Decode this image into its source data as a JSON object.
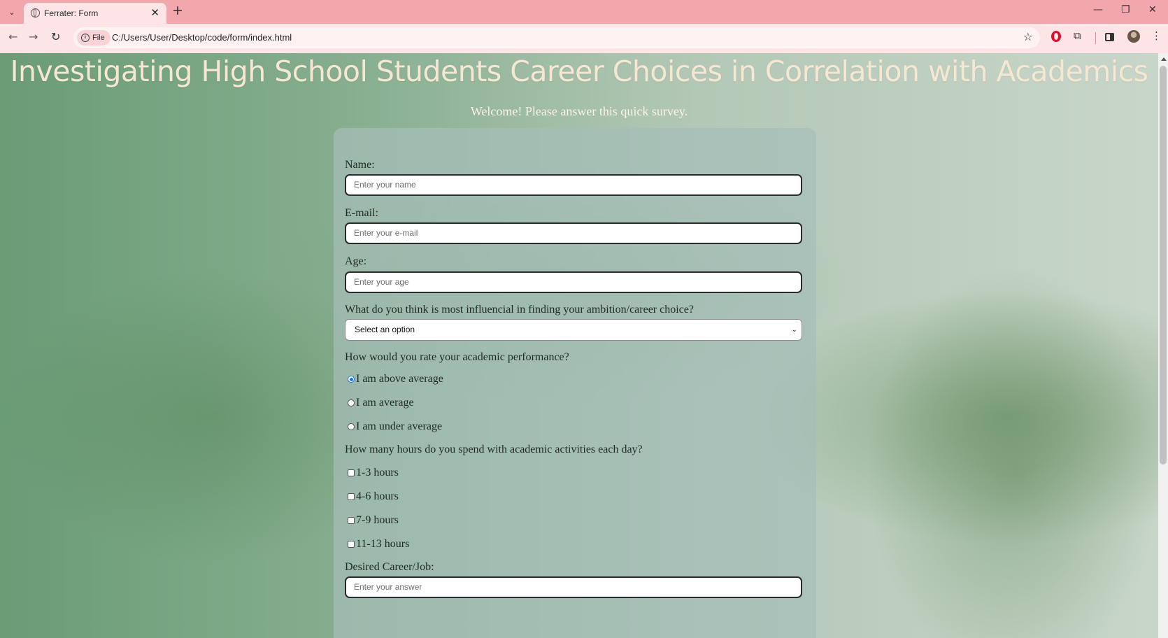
{
  "browser": {
    "tab_title": "Ferrater: Form",
    "tab_close": "✕",
    "new_tab": "+",
    "file_chip": "File",
    "url": "C:/Users/User/Desktop/code/form/index.html",
    "window_controls": [
      "—",
      "❐",
      "✕"
    ]
  },
  "page": {
    "title": "Investigating High School Students Career Choices in Correlation with Academics",
    "welcome": "Welcome! Please answer this quick survey."
  },
  "form": {
    "name_label": "Name:",
    "name_placeholder": "Enter your name",
    "email_label": "E-mail:",
    "email_placeholder": "Enter your e-mail",
    "age_label": "Age:",
    "age_placeholder": "Enter your age",
    "influence_question": "What do you think is most influencial in finding your ambition/career choice?",
    "influence_selected": "Select an option",
    "performance_question": "How would you rate your academic performance?",
    "performance_options": [
      "I am above average",
      "I am average",
      "I am under average"
    ],
    "performance_selected_index": 0,
    "hours_question": "How many hours do you spend with academic activities each day?",
    "hours_options": [
      "1-3 hours",
      "4-6 hours",
      "7-9 hours",
      "11-13 hours"
    ],
    "career_label": "Desired Career/Job:",
    "career_placeholder": "Enter your answer"
  },
  "colors": {
    "tabbar": "#f2a7ac",
    "toolbar": "#fde4e6",
    "title_text": "#f6e7d2",
    "radio_accent": "#1a73e8"
  }
}
